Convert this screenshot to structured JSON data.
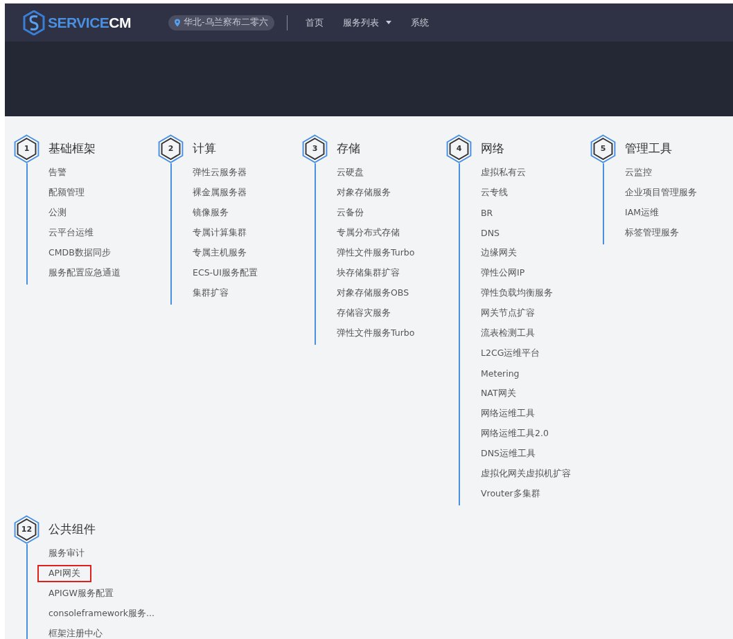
{
  "header": {
    "logo": {
      "text_primary": "SERVICE",
      "text_accent": "CM"
    },
    "region": "华北-乌兰察布二零六",
    "nav": [
      {
        "label": "首页",
        "dropdown": false
      },
      {
        "label": "服务列表",
        "dropdown": true
      },
      {
        "label": "系统",
        "dropdown": false
      }
    ]
  },
  "sections": [
    {
      "number": "1",
      "title": "基础框架",
      "items": [
        {
          "label": "告警",
          "highlighted": false
        },
        {
          "label": "配额管理",
          "highlighted": false
        },
        {
          "label": "公测",
          "highlighted": false
        },
        {
          "label": "云平台运维",
          "highlighted": false
        },
        {
          "label": "CMDB数据同步",
          "highlighted": false
        },
        {
          "label": "服务配置应急通道",
          "highlighted": false
        }
      ]
    },
    {
      "number": "2",
      "title": "计算",
      "items": [
        {
          "label": "弹性云服务器",
          "highlighted": false
        },
        {
          "label": "裸金属服务器",
          "highlighted": false
        },
        {
          "label": "镜像服务",
          "highlighted": false
        },
        {
          "label": "专属计算集群",
          "highlighted": false
        },
        {
          "label": "专属主机服务",
          "highlighted": false
        },
        {
          "label": "ECS-UI服务配置",
          "highlighted": false
        },
        {
          "label": "集群扩容",
          "highlighted": false
        }
      ]
    },
    {
      "number": "3",
      "title": "存储",
      "items": [
        {
          "label": "云硬盘",
          "highlighted": false
        },
        {
          "label": "对象存储服务",
          "highlighted": false
        },
        {
          "label": "云备份",
          "highlighted": false
        },
        {
          "label": "专属分布式存储",
          "highlighted": false
        },
        {
          "label": "弹性文件服务Turbo",
          "highlighted": false
        },
        {
          "label": "块存储集群扩容",
          "highlighted": false
        },
        {
          "label": "对象存储服务OBS",
          "highlighted": false
        },
        {
          "label": "存储容灾服务",
          "highlighted": false
        },
        {
          "label": "弹性文件服务Turbo",
          "highlighted": false
        }
      ]
    },
    {
      "number": "4",
      "title": "网络",
      "items": [
        {
          "label": "虚拟私有云",
          "highlighted": false
        },
        {
          "label": "云专线",
          "highlighted": false
        },
        {
          "label": "BR",
          "highlighted": false
        },
        {
          "label": "DNS",
          "highlighted": false
        },
        {
          "label": "边缘网关",
          "highlighted": false
        },
        {
          "label": "弹性公网IP",
          "highlighted": false
        },
        {
          "label": "弹性负载均衡服务",
          "highlighted": false
        },
        {
          "label": "网关节点扩容",
          "highlighted": false
        },
        {
          "label": "流表检测工具",
          "highlighted": false
        },
        {
          "label": "L2CG运维平台",
          "highlighted": false
        },
        {
          "label": "Metering",
          "highlighted": false
        },
        {
          "label": "NAT网关",
          "highlighted": false
        },
        {
          "label": "网络运维工具",
          "highlighted": false
        },
        {
          "label": "网络运维工具2.0",
          "highlighted": false
        },
        {
          "label": "DNS运维工具",
          "highlighted": false
        },
        {
          "label": "虚拟化网关虚拟机扩容",
          "highlighted": false
        },
        {
          "label": "Vrouter多集群",
          "highlighted": false
        }
      ]
    },
    {
      "number": "5",
      "title": "管理工具",
      "items": [
        {
          "label": "云监控",
          "highlighted": false
        },
        {
          "label": "企业项目管理服务",
          "highlighted": false
        },
        {
          "label": "IAM运维",
          "highlighted": false
        },
        {
          "label": "标签管理服务",
          "highlighted": false
        }
      ]
    },
    {
      "number": "12",
      "title": "公共组件",
      "items": [
        {
          "label": "服务审计",
          "highlighted": false
        },
        {
          "label": "API网关",
          "highlighted": true
        },
        {
          "label": "APIGW服务配置",
          "highlighted": false
        },
        {
          "label": "consoleframework服务...",
          "highlighted": false
        },
        {
          "label": "框架注册中心",
          "highlighted": false
        }
      ]
    }
  ]
}
